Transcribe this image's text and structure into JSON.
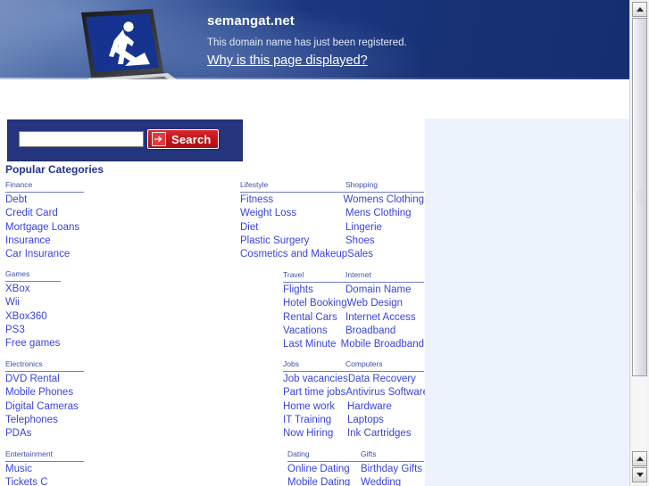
{
  "header": {
    "domain": "semangat.net",
    "registered_note": "This domain name has just been registered.",
    "why_link": "Why is this page displayed?",
    "laptop_icon": "laptop-under-construction-icon",
    "banner_color": "#1b3780"
  },
  "search": {
    "value": "",
    "placeholder": "",
    "button_label": "Search",
    "arrow_icon": "arrow-right-icon",
    "panel_color": "#24357e",
    "button_color": "#c3151b"
  },
  "popular_heading": "Popular Categories",
  "link_color": "#3a44d8",
  "categories": {
    "finance": {
      "head": "Finance",
      "items": [
        "Debt",
        "Credit Card",
        "Mortgage Loans",
        "Insurance",
        "Car Insurance"
      ]
    },
    "games": {
      "head": "Games",
      "items": [
        "XBox",
        "Wii",
        "XBox360",
        "PS3",
        "Free games"
      ]
    },
    "electronics": {
      "head": "Electronics",
      "items": [
        "DVD Rental",
        "Mobile Phones",
        "Digital Cameras",
        "Telephones",
        "PDAs"
      ]
    },
    "entertainment": {
      "head": "Entertainment",
      "items": [
        "Music",
        "Tickets C"
      ]
    },
    "lifestyle": {
      "head_left": "Lifestyle",
      "head_right": "Shopping",
      "rows": [
        {
          "left": "Fitness",
          "right": "Womens Clothing"
        },
        {
          "left": "Weight Loss",
          "right": "Mens Clothing"
        },
        {
          "left": "Diet",
          "right": "Lingerie"
        },
        {
          "left": "Plastic Surgery",
          "right": "Shoes"
        },
        {
          "left": "Cosmetics and Makeup",
          "right": "Sales"
        }
      ]
    },
    "travel": {
      "head_left": "Travel",
      "head_right": "Internet",
      "rows": [
        {
          "left": "Flights",
          "right": "Domain Name"
        },
        {
          "left": "Hotel Booking",
          "right": "Web Design"
        },
        {
          "left": "Rental Cars",
          "right": "Internet Access"
        },
        {
          "left": "Vacations",
          "right": "Broadband"
        },
        {
          "left": "Last Minute",
          "right": "Mobile Broadband"
        }
      ]
    },
    "jobs": {
      "head_left": "Jobs",
      "head_right": "Computers",
      "rows": [
        {
          "left": "Job vacancies",
          "right": "Data Recovery"
        },
        {
          "left": "Part time jobs",
          "right": "Antivirus Software"
        },
        {
          "left": "Home work",
          "right": "Hardware"
        },
        {
          "left": "IT Training",
          "right": "Laptops"
        },
        {
          "left": "Now Hiring",
          "right": "Ink Cartridges"
        }
      ]
    },
    "dating": {
      "head_left": "Dating",
      "head_right": "Gifts",
      "rows": [
        {
          "left": "Online Dating",
          "right": "Birthday Gifts"
        },
        {
          "left": "Mobile Dating",
          "right": "Wedding"
        }
      ]
    }
  },
  "scrollbar": {
    "up_icon": "scroll-up-arrow-icon",
    "down_icon": "scroll-down-arrow-icon",
    "grip_icon": "scrollbar-grip-icon"
  }
}
